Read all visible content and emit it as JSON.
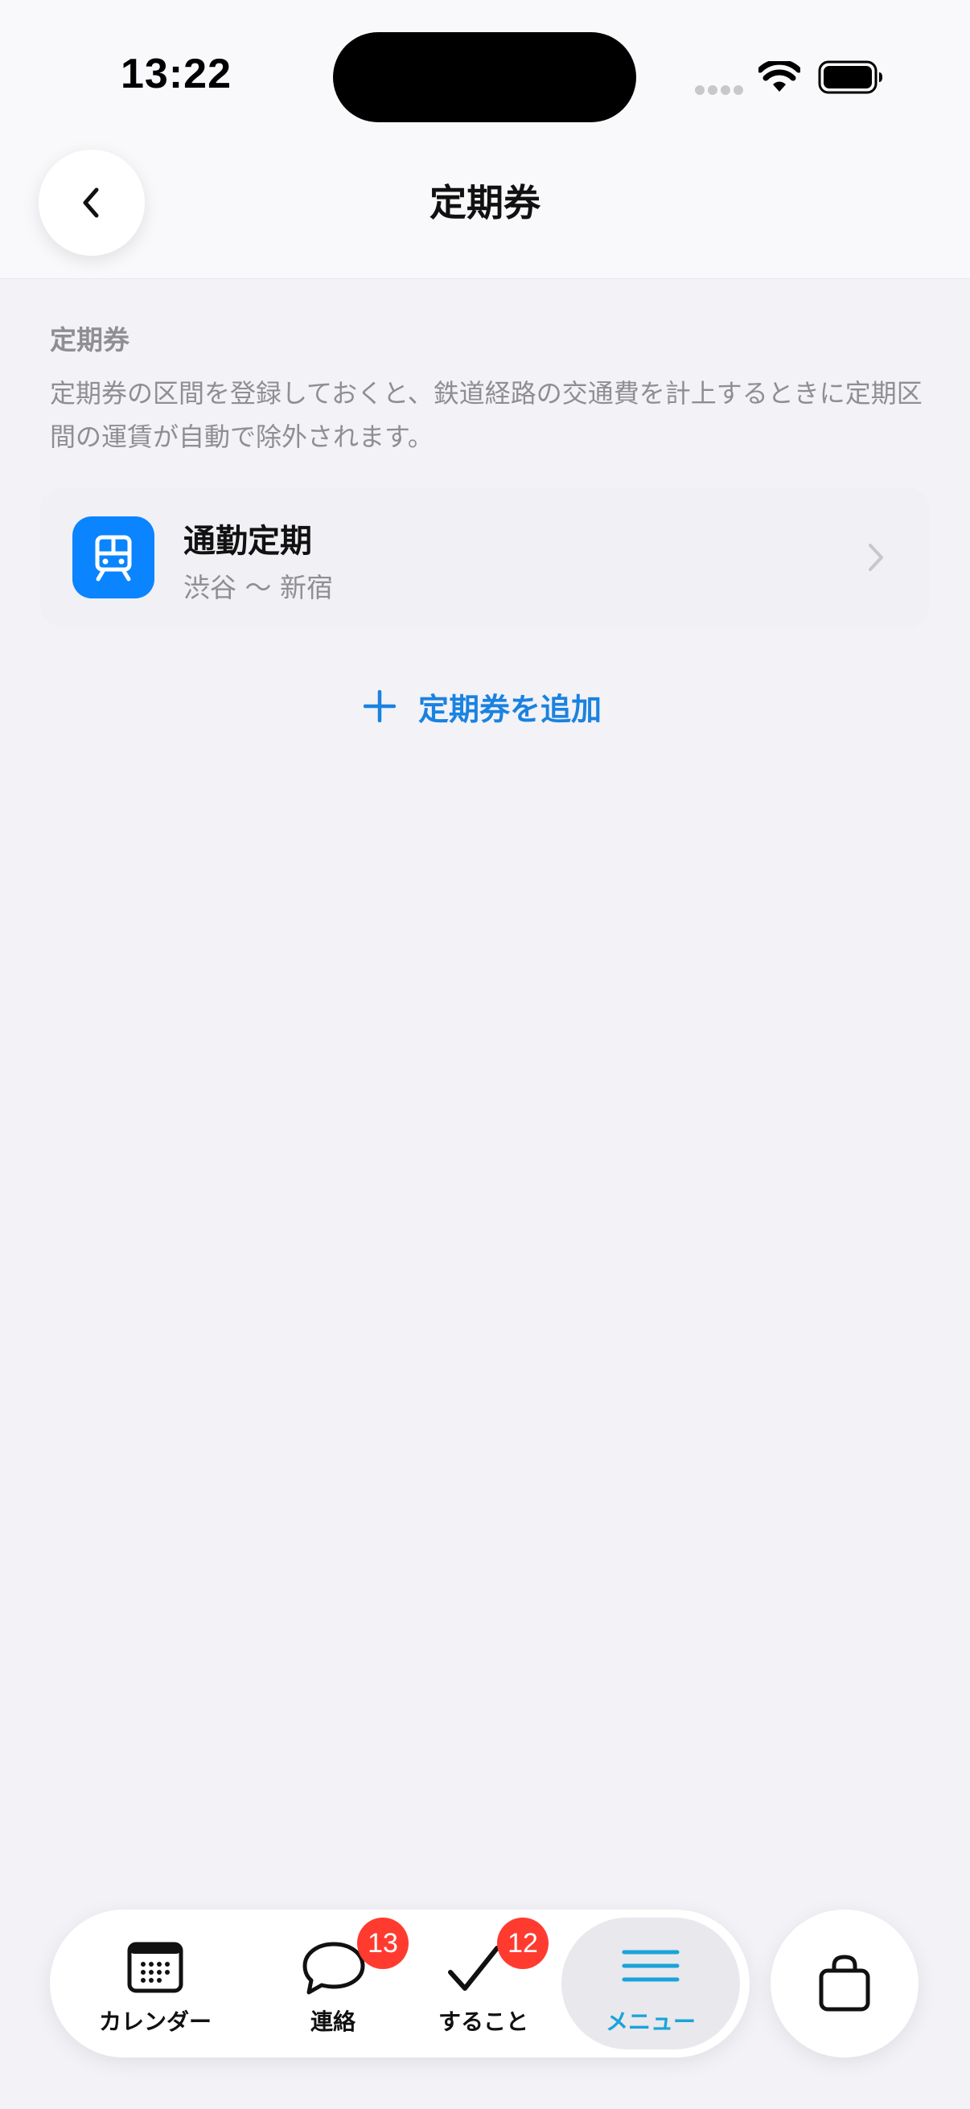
{
  "status_bar": {
    "time": "13:22"
  },
  "header": {
    "title": "定期券"
  },
  "section": {
    "label": "定期券",
    "description": "定期券の区間を登録しておくと、鉄道経路の交通費を計上するときに定期区間の運賃が自動で除外されます。"
  },
  "passes": [
    {
      "name": "通勤定期",
      "route": "渋谷 〜 新宿",
      "icon": "train-icon"
    }
  ],
  "add_pass": {
    "label": "定期券を追加",
    "icon": "plus-icon"
  },
  "tab_bar": {
    "tabs": [
      {
        "label": "カレンダー",
        "icon": "calendar-icon",
        "badge": null
      },
      {
        "label": "連絡",
        "icon": "chat-bubble-icon",
        "badge": "13"
      },
      {
        "label": "すること",
        "icon": "checkmark-icon",
        "badge": "12"
      },
      {
        "label": "メニュー",
        "icon": "hamburger-menu-icon",
        "badge": null,
        "active": true
      }
    ],
    "shop_icon": "shopping-bag-icon"
  },
  "colors": {
    "accent": "#1a82e0",
    "menu_active": "#1aa3d9",
    "badge": "#ff3b30",
    "train_icon_bg": "#0a84ff",
    "background": "#f2f2f7"
  }
}
